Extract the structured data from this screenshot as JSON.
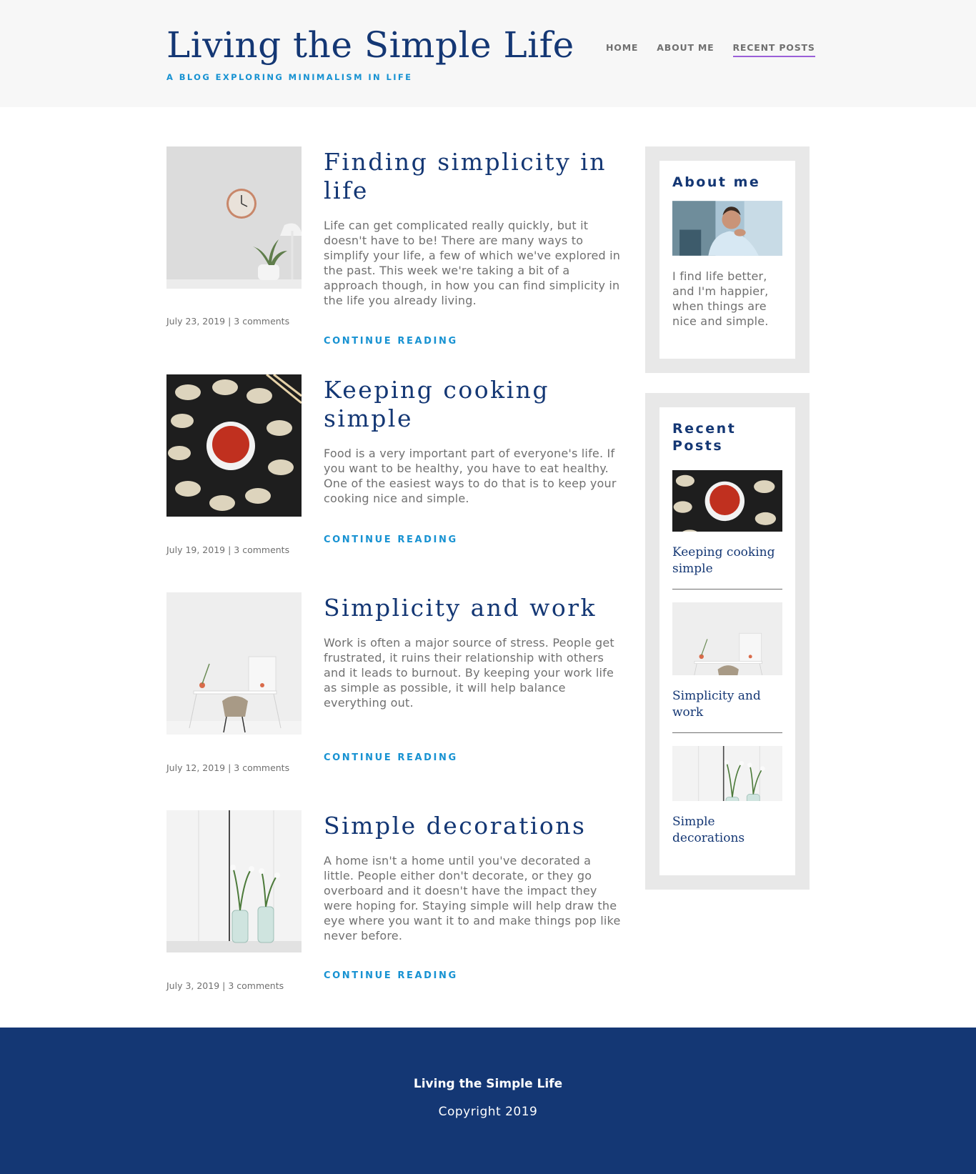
{
  "site": {
    "title": "Living the Simple Life",
    "subtitle": "A BLOG EXPLORING MINIMALISM IN LIFE"
  },
  "nav": {
    "items": [
      {
        "label": "HOME"
      },
      {
        "label": "ABOUT ME"
      },
      {
        "label": "RECENT POSTS"
      }
    ],
    "current": "RECENT POSTS"
  },
  "posts": [
    {
      "title": "Finding simplicity in life",
      "excerpt": "Life can get complicated really quickly, but it doesn't have to be! There are many ways to simplify your life, a few of which we've explored in the past. This week we're taking a bit of a approach though, in how you can find simplicity in the life you already living.",
      "meta": "July 23, 2019 | 3 comments",
      "continue": "CONTINUE READING",
      "image": "wall-clock-and-plant-photo"
    },
    {
      "title": "Keeping cooking simple",
      "excerpt": "Food is a very important part of everyone's life. If you want to be healthy, you have to eat healthy. One of the easiest ways to do that is to keep your cooking nice and simple.",
      "meta": "July 19, 2019 | 3 comments",
      "continue": "CONTINUE READING",
      "image": "dumplings-and-sauce-photo"
    },
    {
      "title": "Simplicity and work",
      "excerpt": "Work is often a major source of stress. People get frustrated, it ruins their relationship with others and it leads to burnout. By keeping your work life as simple as possible, it will help balance everything out.",
      "meta": "July 12, 2019 | 3 comments",
      "continue": "CONTINUE READING",
      "image": "desk-and-chair-photo"
    },
    {
      "title": "Simple decorations",
      "excerpt": "A home isn't a home until you've decorated a little. People either don't decorate, or they go overboard and it doesn't have the impact they were hoping for. Staying simple will help draw the eye where you want it to and make things pop like never before.",
      "meta": "July 3, 2019 | 3 comments",
      "continue": "CONTINUE READING",
      "image": "flower-vases-photo"
    }
  ],
  "sidebar": {
    "about": {
      "title": "About me",
      "text": "I find life better, and I'm happier, when things are nice and simple.",
      "image": "smiling-man-photo"
    },
    "recent": {
      "title": "Recent Posts",
      "items": [
        {
          "title": "Keeping cooking simple",
          "image": "dumplings-and-sauce-photo"
        },
        {
          "title": "Simplicity and work",
          "image": "desk-and-chair-photo"
        },
        {
          "title": "Simple decorations",
          "image": "flower-vases-photo"
        }
      ]
    }
  },
  "footer": {
    "title": "Living the Simple Life",
    "copyright": "Copyright 2019"
  },
  "colors": {
    "navy": "#143774",
    "accent_blue": "#1792d2",
    "nav_underline": "#9a5fd8",
    "text_gray": "#707070",
    "header_bg": "#f7f7f7",
    "sidebar_bg": "#e8e8e8"
  }
}
